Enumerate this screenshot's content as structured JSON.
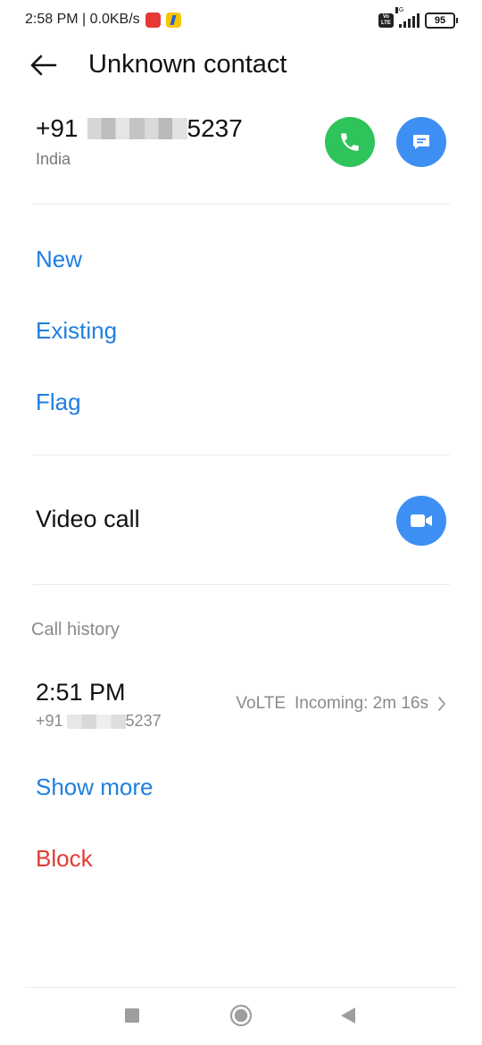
{
  "status_bar": {
    "time_speed": "2:58 PM | 0.0KB/s",
    "volte_badge": "Vo LTE",
    "network_type": "4G",
    "battery": "95",
    "icons": [
      "app-notification-icon",
      "flipkart-icon",
      "volte-icon",
      "signal-icon",
      "battery-icon"
    ]
  },
  "header": {
    "title": "Unknown contact",
    "back_icon": "arrow-left-icon"
  },
  "contact": {
    "number_prefix": "+91",
    "number_suffix": "5237",
    "country": "India"
  },
  "actions": {
    "new_label": "New",
    "existing_label": "Existing",
    "flag_label": "Flag"
  },
  "video_call": {
    "label": "Video call"
  },
  "call_history": {
    "title": "Call history",
    "entries": [
      {
        "time": "2:51 PM",
        "number_prefix": "+91",
        "number_suffix": "5237",
        "network": "VoLTE",
        "detail": "Incoming: 2m 16s"
      }
    ]
  },
  "show_more_label": "Show more",
  "block_label": "Block",
  "colors": {
    "link_blue": "#1f7fe0",
    "call_green": "#2fc35b",
    "action_blue": "#3d8ff3",
    "block_red": "#e23b35"
  }
}
